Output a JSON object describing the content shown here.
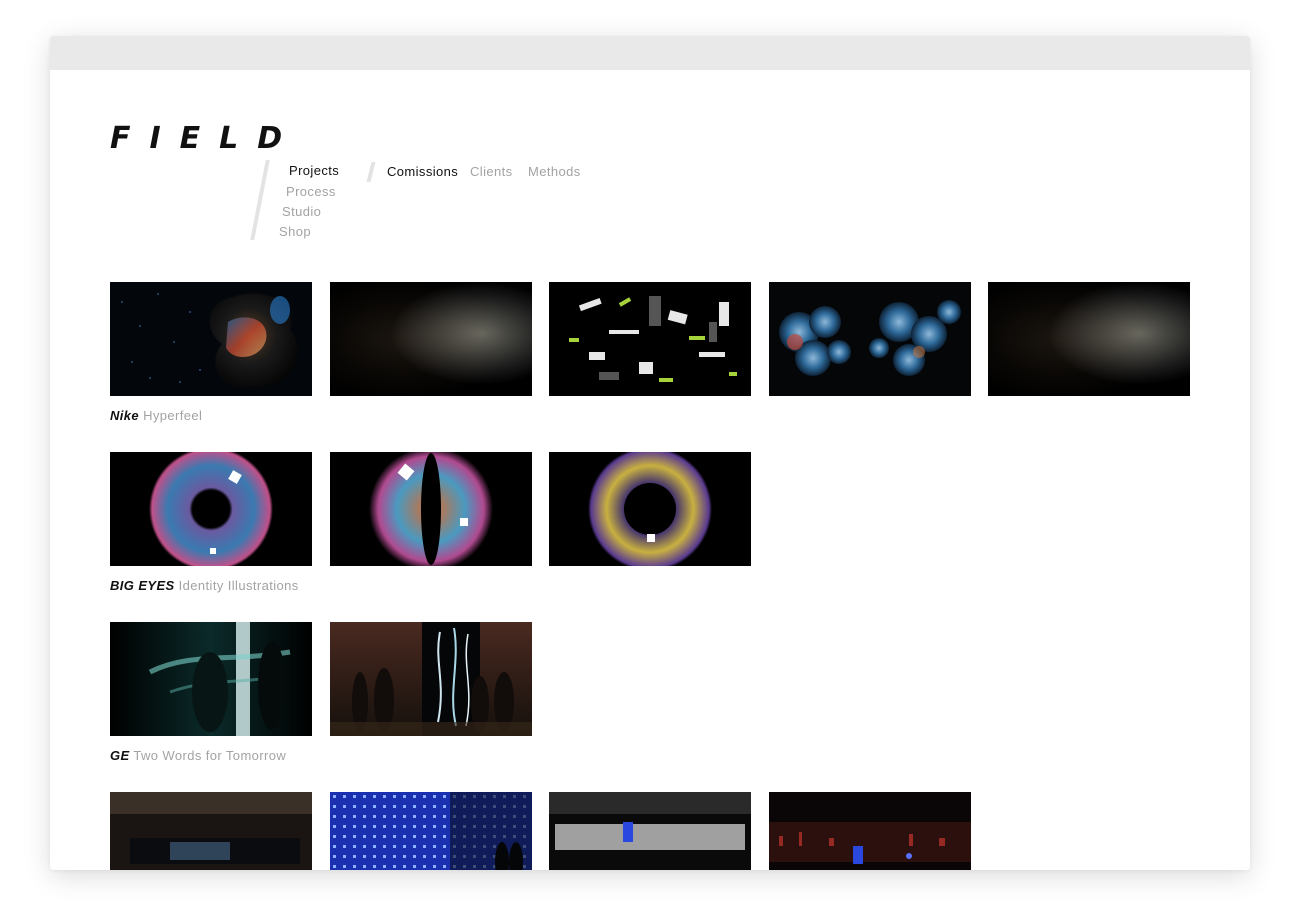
{
  "brand": {
    "logo": "FIELD"
  },
  "nav": {
    "primary": [
      {
        "label": "Projects",
        "active": true
      },
      {
        "label": "Process",
        "active": false
      },
      {
        "label": "Studio",
        "active": false
      },
      {
        "label": "Shop",
        "active": false
      }
    ],
    "secondary": [
      {
        "label": "Comissions",
        "active": true
      },
      {
        "label": "Clients",
        "active": false
      },
      {
        "label": "Methods",
        "active": false
      }
    ]
  },
  "projects": [
    {
      "client": "Nike",
      "title": "Hyperfeel",
      "thumbnails": 5
    },
    {
      "client": "BIG EYES",
      "title": "Identity Illustrations",
      "thumbnails": 3
    },
    {
      "client": "GE",
      "title": "Two Words for Tomorrow",
      "thumbnails": 2
    },
    {
      "client": "",
      "title": "",
      "thumbnails": 4
    }
  ],
  "colors": {
    "text": "#111111",
    "muted": "#a3a3a3",
    "chrome": "#e9e9e9"
  }
}
